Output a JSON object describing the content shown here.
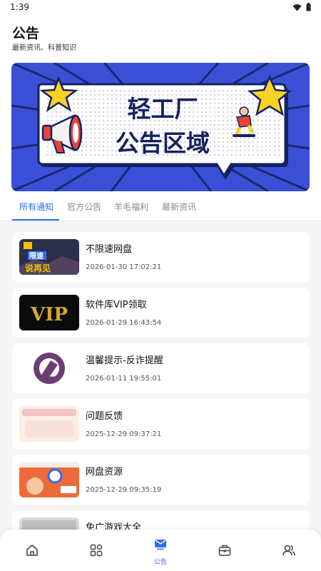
{
  "status": {
    "time": "1:39"
  },
  "header": {
    "title": "公告",
    "subtitle": "最新资讯、科普知识"
  },
  "banner": {
    "line1": "轻工厂",
    "line2": "公告区域"
  },
  "tabs": [
    {
      "label": "所有通知",
      "active": true
    },
    {
      "label": "官方公告",
      "active": false
    },
    {
      "label": "羊毛福利",
      "active": false
    },
    {
      "label": "最新资讯",
      "active": false
    }
  ],
  "notices": [
    {
      "title": "不限速网盘",
      "date": "2026-01-30 17:02:21",
      "thumb_text": [
        "限速",
        "说再见"
      ]
    },
    {
      "title": "软件库VIP领取",
      "date": "2026-01-29 16:43:54",
      "thumb_text": [
        "VIP"
      ]
    },
    {
      "title": "温馨提示-反诈提醒",
      "date": "2026-01-11 19:55:01"
    },
    {
      "title": "问题反馈",
      "date": "2025-12-29 09:37:21"
    },
    {
      "title": "网盘资源",
      "date": "2025-12-29 09:35:19"
    },
    {
      "title": "免广游戏大全",
      "date": ""
    }
  ],
  "bottom_nav": [
    {
      "icon": "home-icon",
      "label": ""
    },
    {
      "icon": "grid-icon",
      "label": ""
    },
    {
      "icon": "announcement-icon",
      "label": "公告",
      "active": true
    },
    {
      "icon": "toolbox-icon",
      "label": ""
    },
    {
      "icon": "users-icon",
      "label": ""
    }
  ],
  "colors": {
    "accent": "#2f6df6",
    "banner_blue": "#3b4fd6",
    "banner_navy": "#14225e"
  }
}
